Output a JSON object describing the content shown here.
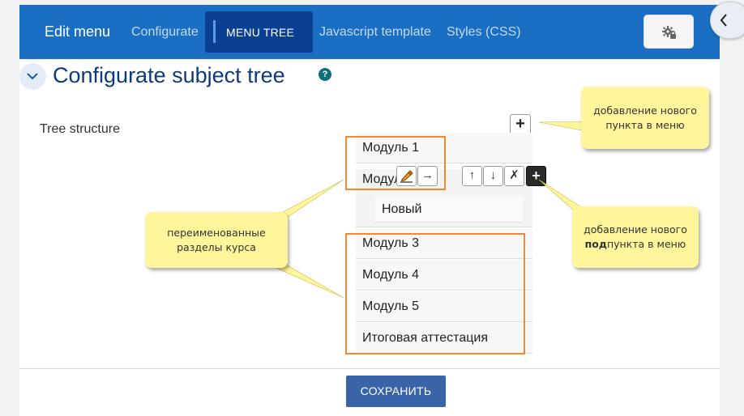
{
  "navbar": {
    "title": "Edit menu",
    "links": [
      "Configurate",
      "Javascript template",
      "Styles (CSS)"
    ],
    "active_tab": "MENU TREE"
  },
  "section": {
    "title": "Configurate subject tree",
    "help": "?"
  },
  "field": {
    "label": "Tree structure",
    "add_label": "+"
  },
  "tree": {
    "items": [
      "Модуль 1",
      "Модуль",
      "Модуль 3",
      "Модуль 4",
      "Модуль 5",
      "Итоговая аттестация"
    ],
    "sub_item": "Новый"
  },
  "toolbar": {
    "move_right": "→",
    "move_up": "↑",
    "move_down": "↓",
    "delete": "✗",
    "add_child": "+"
  },
  "callouts": {
    "add_item": "добавление нового пункта в меню",
    "add_subitem_pre": "добавление нового ",
    "add_subitem_bold": "под",
    "add_subitem_post": "пункта в меню",
    "renamed": "переименованные разделы курса"
  },
  "save_label": "СОХРАНИТЬ",
  "colors": {
    "navbar": "#1a6fc2",
    "active_tab": "#0b3f91",
    "highlight": "#ec8a36",
    "callout": "#fff59b",
    "save_button": "#3a64a8"
  }
}
